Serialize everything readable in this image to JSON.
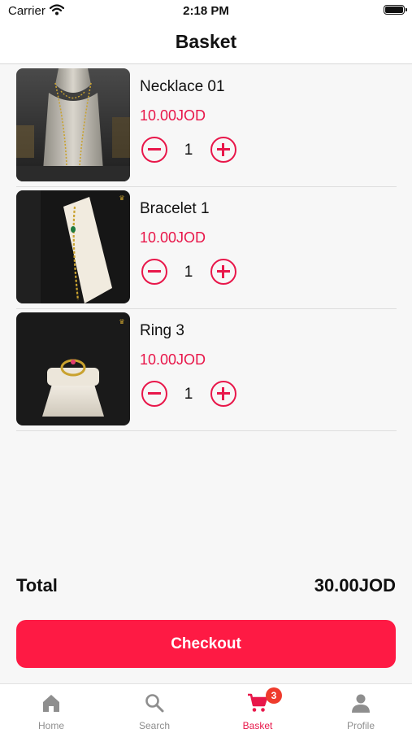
{
  "status_bar": {
    "carrier": "Carrier",
    "time": "2:18 PM"
  },
  "header": {
    "title": "Basket"
  },
  "items": [
    {
      "name": "Necklace 01",
      "price": "10.00JOD",
      "quantity": "1",
      "image": "necklace-photo"
    },
    {
      "name": "Bracelet 1",
      "price": "10.00JOD",
      "quantity": "1",
      "image": "bracelet-photo"
    },
    {
      "name": "Ring 3",
      "price": "10.00JOD",
      "quantity": "1",
      "image": "ring-photo"
    }
  ],
  "summary": {
    "total_label": "Total",
    "total_value": "30.00JOD"
  },
  "checkout_label": "Checkout",
  "tabs": [
    {
      "label": "Home",
      "icon": "home-icon"
    },
    {
      "label": "Search",
      "icon": "search-icon"
    },
    {
      "label": "Basket",
      "icon": "cart-icon",
      "badge": "3",
      "active": true
    },
    {
      "label": "Profile",
      "icon": "person-icon"
    }
  ],
  "colors": {
    "accent": "#e8174a",
    "checkout": "#fe1a44",
    "badge": "#ef3b2c"
  }
}
